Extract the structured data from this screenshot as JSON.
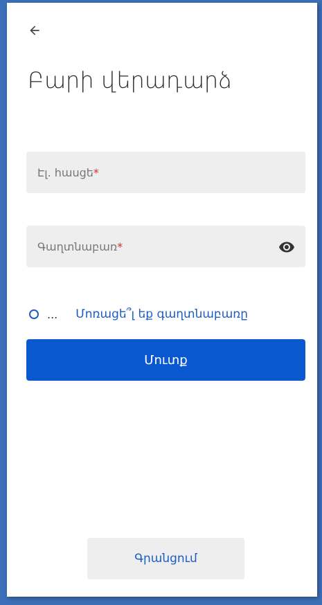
{
  "header": {
    "title": "Բարի վերադարձ"
  },
  "form": {
    "email_placeholder": "Էլ. հասցե",
    "email_required_marker": "*",
    "password_placeholder": "Գաղտնաբառ",
    "password_required_marker": "*",
    "remember_text": "...",
    "forgot_link": "Մոռացե՞լ եք գաղտնաբառը",
    "login_button": "Մուտք",
    "register_button": "Գրանցում"
  },
  "icons": {
    "back": "arrow-left-icon",
    "visibility": "eye-icon"
  },
  "colors": {
    "primary": "#0a58d0",
    "link": "#1b5cc6",
    "required": "#d32f2f",
    "field_bg": "#eeeeee"
  }
}
